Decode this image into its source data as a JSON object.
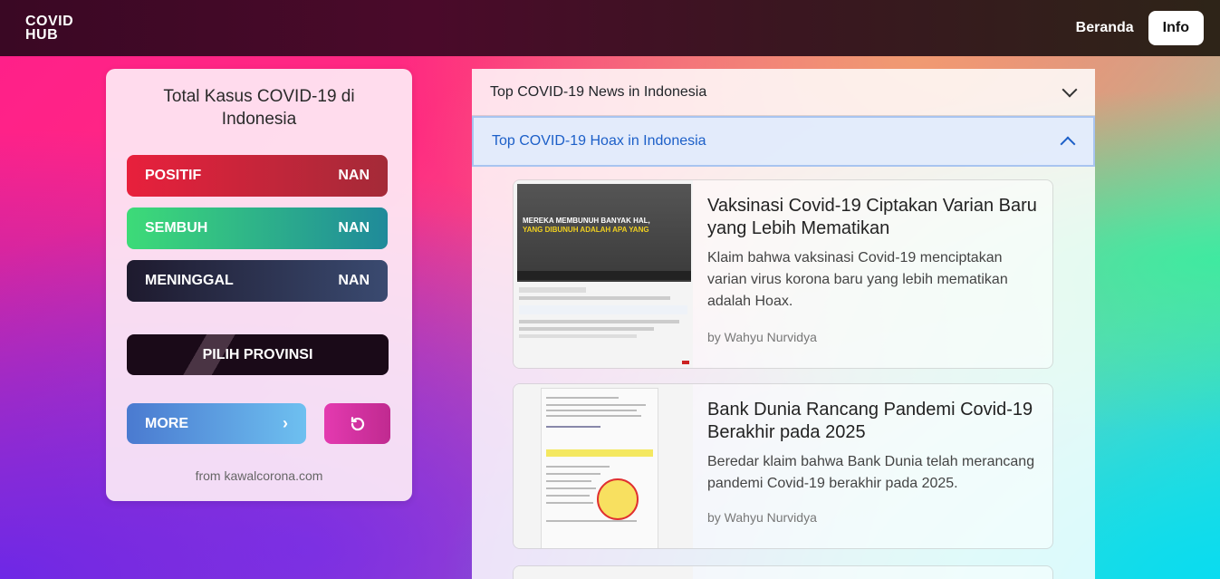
{
  "navbar": {
    "logo_line1": "COVID",
    "logo_line2": "HUB",
    "links": [
      "Beranda"
    ],
    "info_button": "Info"
  },
  "summary": {
    "title": "Total Kasus COVID-19 di Indonesia",
    "stats": [
      {
        "label": "POSITIF",
        "value": "NAN"
      },
      {
        "label": "SEMBUH",
        "value": "NAN"
      },
      {
        "label": "MENINGGAL",
        "value": "NAN"
      }
    ],
    "province_button": "PILIH PROVINSI",
    "more_button": "MORE",
    "source": "from kawalcorona.com"
  },
  "accordion": {
    "items": [
      {
        "label": "Top COVID-19 News in Indonesia",
        "expanded": false
      },
      {
        "label": "Top COVID-19 Hoax in Indonesia",
        "expanded": true
      }
    ]
  },
  "hoaxes": [
    {
      "title": "Vaksinasi Covid-19 Ciptakan Varian Baru yang Lebih Mematikan",
      "description": "Klaim bahwa vaksinasi Covid-19 menciptakan varian virus korona baru yang lebih mematikan adalah Hoax.",
      "author": "by Wahyu Nurvidya",
      "thumb_text_1": "MEREKA MEMBUNUH BANYAK HAL,",
      "thumb_text_2": "YANG DIBUNUH ADALAH APA YANG"
    },
    {
      "title": "Bank Dunia Rancang Pandemi Covid-19 Berakhir pada 2025",
      "description": "Beredar klaim bahwa Bank Dunia telah merancang pandemi Covid-19 berakhir pada 2025.",
      "author": "by Wahyu Nurvidya"
    }
  ]
}
